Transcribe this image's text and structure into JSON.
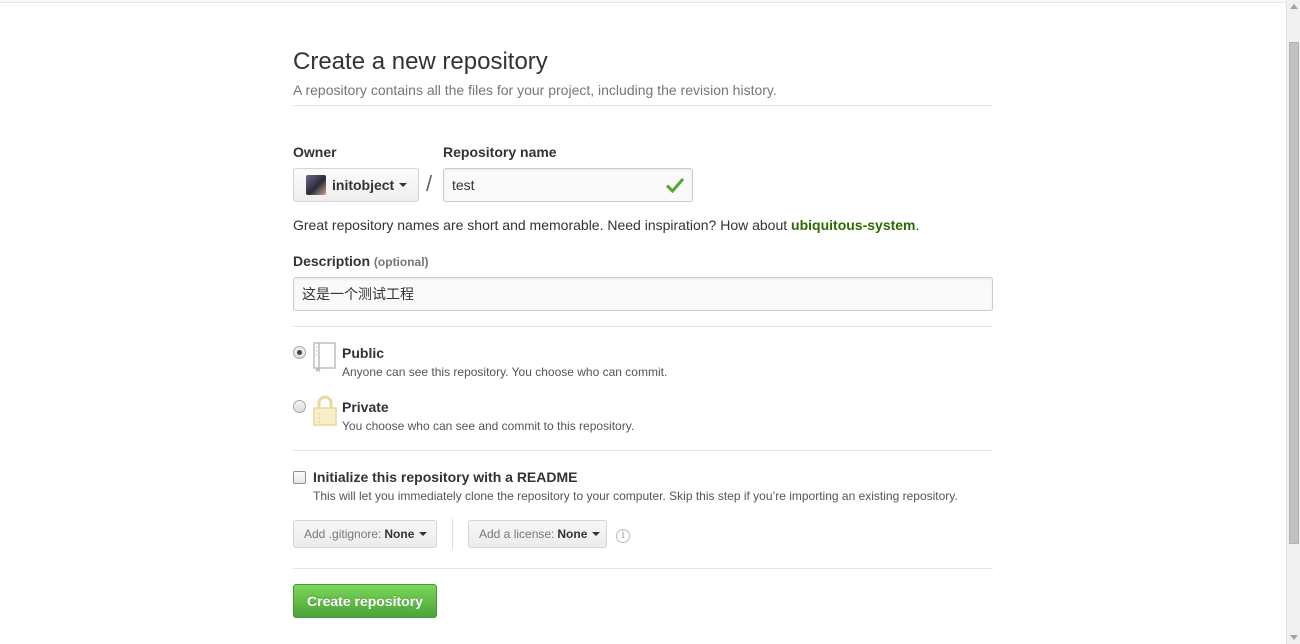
{
  "header": {
    "title": "Create a new repository",
    "subtitle": "A repository contains all the files for your project, including the revision history."
  },
  "owner": {
    "label": "Owner",
    "value": "initobject"
  },
  "repo_name": {
    "label": "Repository name",
    "value": "test",
    "separator": "/"
  },
  "hint": {
    "prefix": "Great repository names are short and memorable. Need inspiration? How about ",
    "suggestion": "ubiquitous-system",
    "suffix": "."
  },
  "description": {
    "label": "Description",
    "optional": "(optional)",
    "value": "这是一个测试工程"
  },
  "visibility": {
    "selected": "public",
    "public": {
      "title": "Public",
      "desc": "Anyone can see this repository. You choose who can commit."
    },
    "private": {
      "title": "Private",
      "desc": "You choose who can see and commit to this repository."
    }
  },
  "init_readme": {
    "checked": false,
    "title": "Initialize this repository with a README",
    "desc": "This will let you immediately clone the repository to your computer. Skip this step if you’re importing an existing repository."
  },
  "gitignore": {
    "label": "Add .gitignore:",
    "value": "None"
  },
  "license": {
    "label": "Add a license:",
    "value": "None"
  },
  "info_icon": "info-icon",
  "submit": {
    "label": "Create repository"
  },
  "colors": {
    "accent_green": "#55a532",
    "suggestion_green": "#2d6a00",
    "check_green": "#55a532"
  }
}
